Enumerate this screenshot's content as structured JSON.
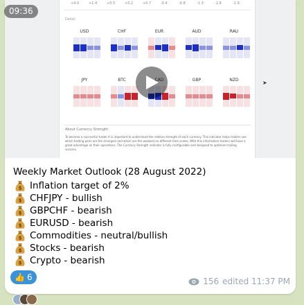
{
  "time_badge": "09:36",
  "media": {
    "scale_ticks": [
      "+4.0",
      "+1.4",
      "+0.5",
      "+0.2",
      "+0.7",
      "-0.4",
      "-0.8",
      "-1.3",
      "-1.8",
      "-1.9"
    ],
    "panel_label": "Detail",
    "currencies_row1": [
      "USD",
      "CHF",
      "EUR",
      "AUD",
      "RAU"
    ],
    "currencies_row2": [
      "JPY",
      "BTC",
      "CAD",
      "GBP",
      "NZD"
    ],
    "about_title": "About Currency Strength",
    "about_text": "To become a successful trader it is important to understand the relative strength of each currency. This indicator helps traders see which trading pairs are the strongest and which are the weakest on different time scales. With this information traders will have a great advantage on their operations. The Currency Strength indicator is fully configurable and designed to optimize trading success."
  },
  "message": {
    "title": "Weekly Market Outlook (28 August 2022)",
    "lines": [
      "Inflation target of 2%",
      "CHFJPY - bullish",
      "GBPCHF - bearish",
      "EURUSD - bearish",
      "Commodities - neutral/bullish",
      "Stocks - bearish",
      "Crypto - bearish"
    ],
    "line_icon": "money-bag-icon",
    "reaction": {
      "emoji": "👍",
      "count": "6"
    },
    "views": "156",
    "edited": "edited 11:37 PM"
  },
  "colors": {
    "strong_blue": "#1d2fc4",
    "weak_red": "#c8232c",
    "reaction_bg": "#3a93d8",
    "meta_text": "#9aa7b3"
  }
}
